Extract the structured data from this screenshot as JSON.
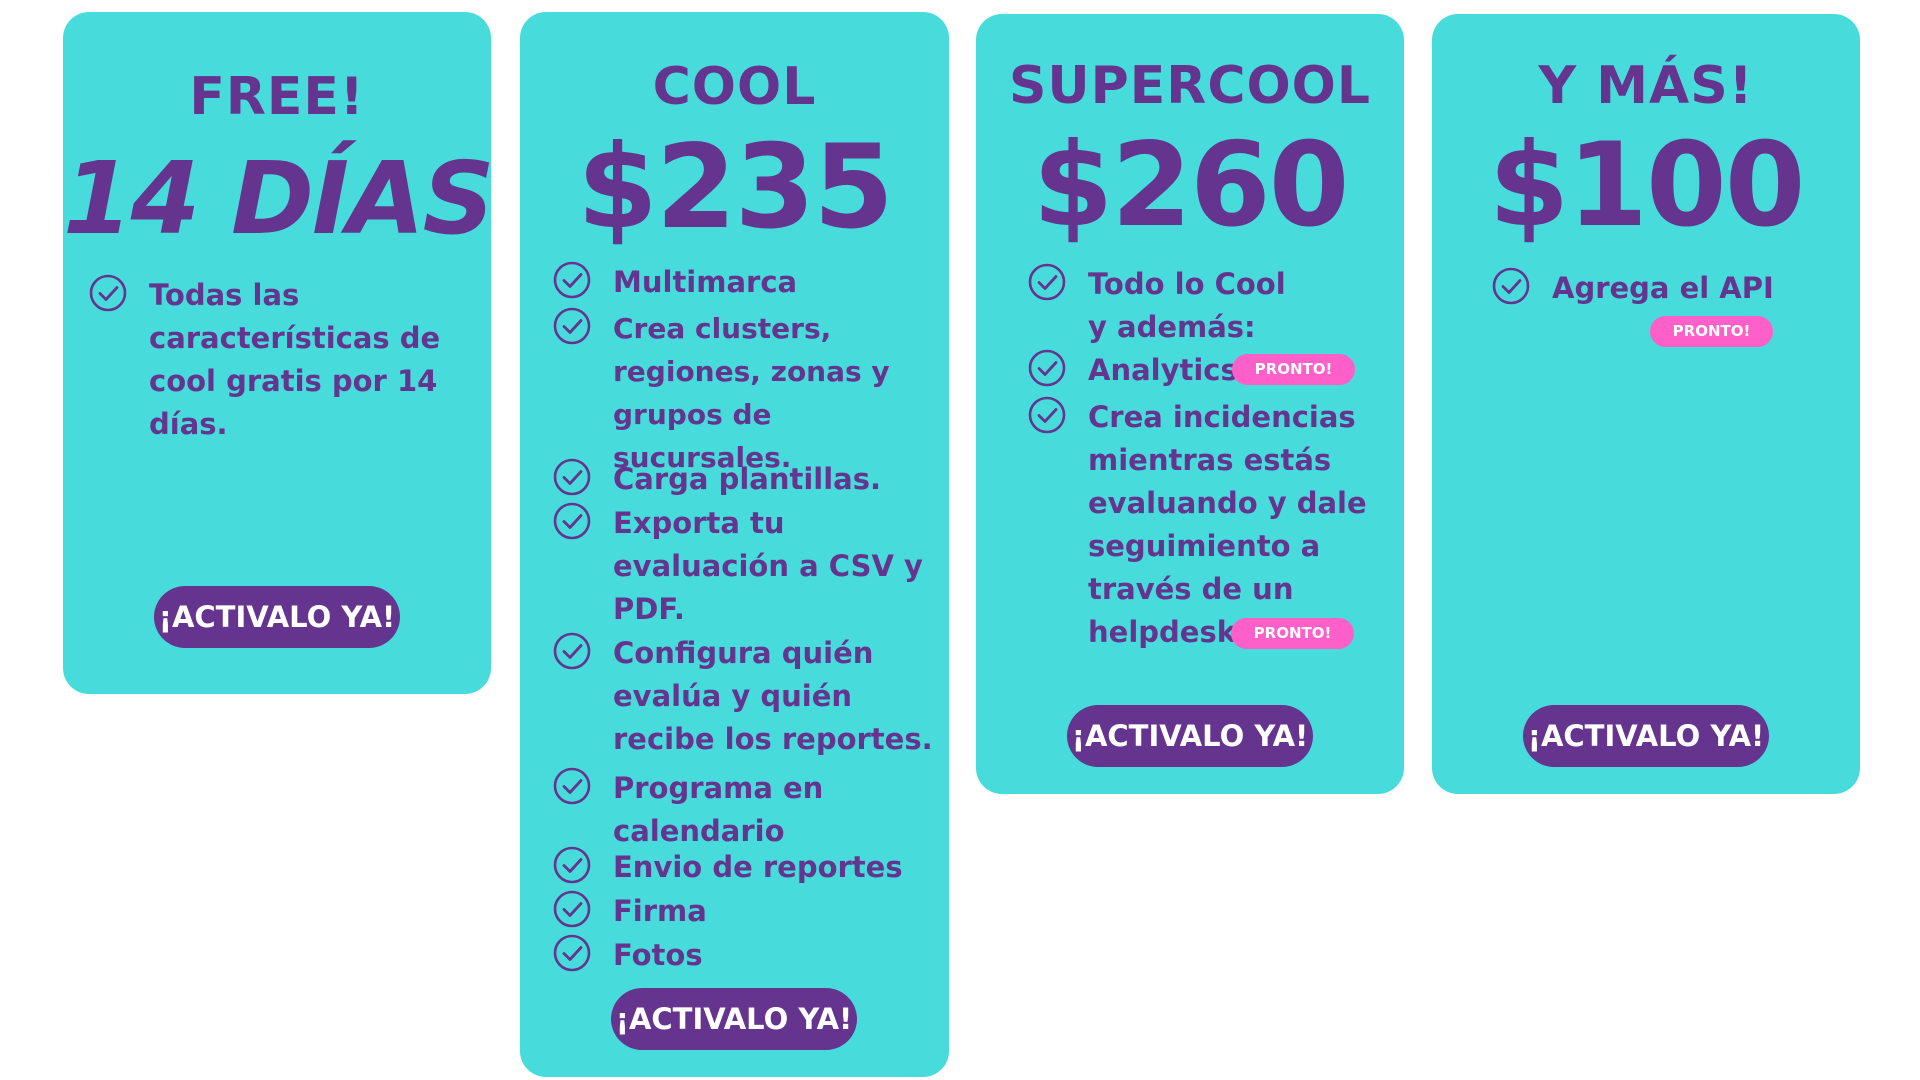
{
  "plans": [
    {
      "name": "FREE!",
      "price": "14 DÍAS",
      "features": [
        {
          "text": "Todas las\ncaracterísticas de\ncool gratis por 14\ndías."
        }
      ],
      "cta": "¡ACTIVALO YA!"
    },
    {
      "name": "COOL",
      "price": "$235",
      "features": [
        {
          "text": "Multimarca"
        },
        {
          "text": "Crea clusters,\nregiones, zonas y\ngrupos de sucursales."
        },
        {
          "text": "Carga plantillas."
        },
        {
          "text": "Exporta tu\nevaluación a CSV y\nPDF."
        },
        {
          "text": "Configura quién\nevalúa y quién\nrecibe los reportes."
        },
        {
          "text": "Programa en\ncalendario"
        },
        {
          "text": "Envio de reportes"
        },
        {
          "text": "Firma"
        },
        {
          "text": "Fotos"
        }
      ],
      "cta": "¡ACTIVALO YA!"
    },
    {
      "name": "SUPERCOOL",
      "price": "$260",
      "features": [
        {
          "text": "Todo lo Cool\ny además:"
        },
        {
          "text": "Analytics",
          "badge": "PRONTO!"
        },
        {
          "text": "Crea incidencias\nmientras estás\nevaluando y dale\nseguimiento a\ntravés de un\nhelpdesk.",
          "badge": "PRONTO!"
        }
      ],
      "cta": "¡ACTIVALO YA!"
    },
    {
      "name": "Y MÁS!",
      "price": "$100",
      "features": [
        {
          "text": "Agrega el API",
          "badge": "PRONTO!"
        }
      ],
      "cta": "¡ACTIVALO YA!"
    }
  ],
  "colors": {
    "card": "#48dbdb",
    "text": "#64348f",
    "button": "#64348f",
    "badge": "#ff5fc8"
  },
  "icons": {
    "feature": "check-circle-icon"
  }
}
